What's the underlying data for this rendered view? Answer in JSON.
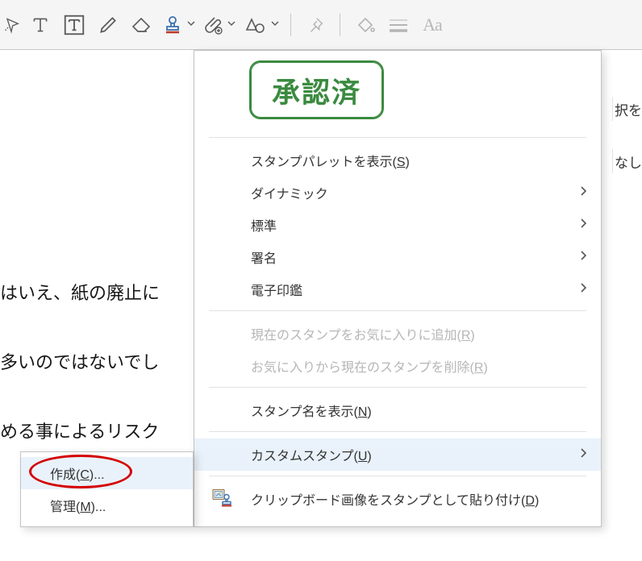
{
  "toolbar": {
    "icons": [
      {
        "name": "hand-icon",
        "glyph": "hand"
      },
      {
        "name": "text-tool-icon",
        "glyph": "T"
      },
      {
        "name": "text-box-icon",
        "glyph": "Tbox"
      },
      {
        "name": "pencil-icon",
        "glyph": "pencil"
      },
      {
        "name": "eraser-icon",
        "glyph": "eraser"
      },
      {
        "name": "stamp-icon",
        "glyph": "stamp",
        "caret": true
      },
      {
        "name": "attach-icon",
        "glyph": "clip",
        "caret": true
      },
      {
        "name": "draw-tools-icon",
        "glyph": "shapes",
        "caret": true
      },
      {
        "name": "separator"
      },
      {
        "name": "pin-icon",
        "glyph": "pin"
      },
      {
        "name": "separator"
      },
      {
        "name": "fill-icon",
        "glyph": "paint"
      },
      {
        "name": "line-width-icon",
        "glyph": "lines"
      },
      {
        "name": "font-icon",
        "glyph": "Aa"
      }
    ]
  },
  "document": {
    "line1": "はいえ、紙の廃止に",
    "line2": "多いのではないでし",
    "line3": "める事によるリスク"
  },
  "right_sidebar": {
    "fragment1": "択を",
    "fragment2": "なし"
  },
  "stamp_preview": {
    "text": "承認済"
  },
  "menu": {
    "show_palette": {
      "text": "スタンプパレットを表示(S)",
      "accel": "S"
    },
    "dynamic": {
      "text": "ダイナミック"
    },
    "standard": {
      "text": "標準"
    },
    "signature": {
      "text": "署名"
    },
    "e_seal": {
      "text": "電子印鑑"
    },
    "add_fav": {
      "text": "現在のスタンプをお気に入りに追加(R)",
      "accel": "R"
    },
    "remove_fav": {
      "text": "お気に入りから現在のスタンプを削除(R)",
      "accel": "R"
    },
    "show_name": {
      "text": "スタンプ名を表示(N)",
      "accel": "N"
    },
    "custom": {
      "text": "カスタムスタンプ(U)",
      "accel": "U"
    },
    "paste_clip": {
      "text": "クリップボード画像をスタンプとして貼り付け(D)",
      "accel": "D"
    }
  },
  "submenu": {
    "create": {
      "text": "作成(C)...",
      "accel": "C"
    },
    "manage": {
      "text": "管理(M)...",
      "accel": "M"
    }
  }
}
